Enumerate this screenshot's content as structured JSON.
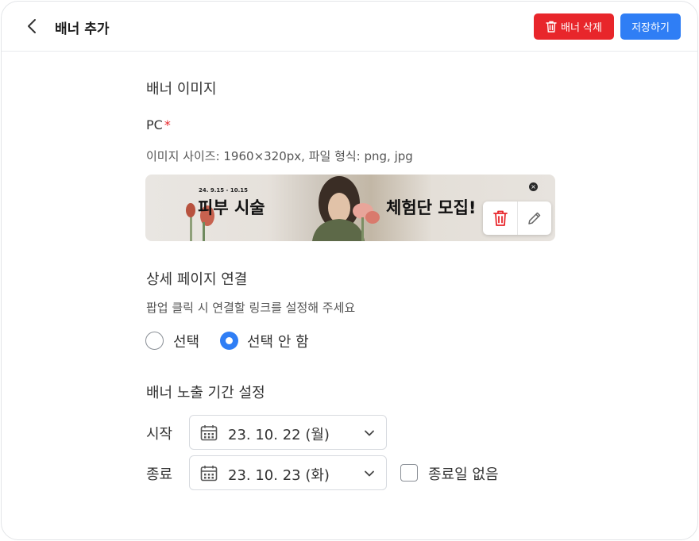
{
  "header": {
    "title": "배너 추가",
    "delete_label": "배너 삭제",
    "save_label": "저장하기"
  },
  "banner_image": {
    "section_title": "배너 이미지",
    "pc_label": "PC",
    "required_mark": "*",
    "size_hint": "이미지 사이즈: 1960×320px, 파일 형식: png, jpg",
    "preview": {
      "date_text": "24. 9.15 - 10.15",
      "headline_left": "피부 시술",
      "headline_right": "체험단 모집!"
    }
  },
  "detail_link": {
    "section_title": "상세 페이지 연결",
    "hint": "팝업 클릭 시 연결할 링크를 설정해 주세요",
    "options": [
      {
        "label": "선택",
        "selected": false
      },
      {
        "label": "선택 안 함",
        "selected": true
      }
    ]
  },
  "period": {
    "section_title": "배너 노출 기간 설정",
    "start_label": "시작",
    "start_value": "23. 10. 22 (월)",
    "end_label": "종료",
    "end_value": "23. 10. 23 (화)",
    "no_end_label": "종료일 없음",
    "no_end_checked": false
  },
  "colors": {
    "danger": "#e8262b",
    "primary": "#2f7ef5",
    "text": "#333333"
  },
  "icons": [
    "chevron-left-icon",
    "trash-icon",
    "close-icon",
    "pencil-icon",
    "calendar-icon",
    "chevron-down-icon"
  ]
}
